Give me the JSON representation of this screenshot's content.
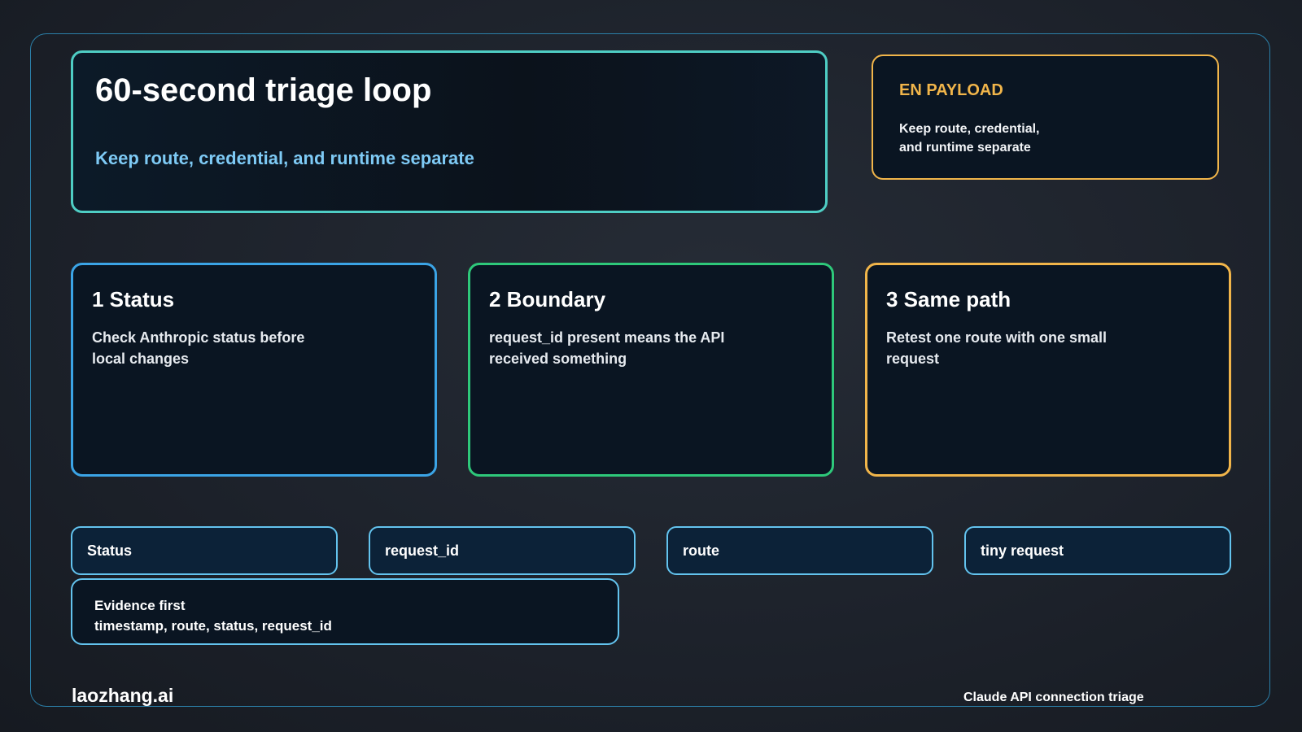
{
  "hero": {
    "title": "60-second triage loop",
    "subtitle": "Keep route, credential, and runtime separate"
  },
  "payload": {
    "label": "EN PAYLOAD",
    "line1": "Keep route, credential,",
    "line2": "and runtime separate"
  },
  "steps": [
    {
      "title": "1 Status",
      "body": "Check Anthropic status before local changes"
    },
    {
      "title": "2 Boundary",
      "body": "request_id present means the API received something"
    },
    {
      "title": "3 Same path",
      "body": "Retest one route with one small request"
    }
  ],
  "chips": [
    "Status",
    "request_id",
    "route",
    "tiny request"
  ],
  "evidence": {
    "title": "Evidence first",
    "body": "timestamp, route, status, request_id"
  },
  "footer": {
    "brand": "laozhang.ai",
    "caption": "Claude API connection triage"
  },
  "colors": {
    "hero_border": "#4ecdc4",
    "payload_border": "#f1b54a",
    "step1_border": "#3ba4e6",
    "step2_border": "#2ec87a",
    "step3_border": "#f1b54a",
    "chip_border": "#63c3ee",
    "frame_border": "#2b7fa8"
  }
}
